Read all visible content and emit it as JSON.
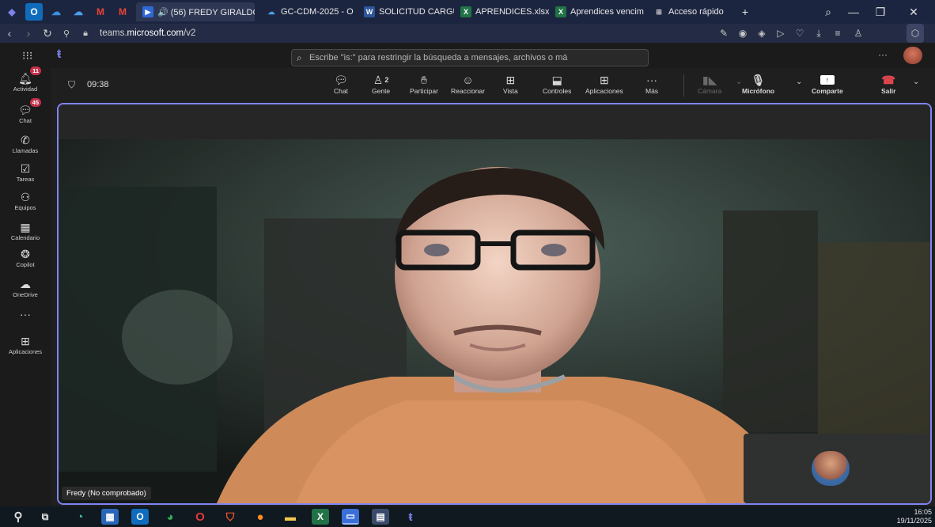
{
  "browser": {
    "tabs": [
      {
        "label": "🔊 (56) FREDY GIRALDO",
        "icon": "youtube-icon",
        "color": "#2f68d8"
      },
      {
        "label": "GC-CDM-2025 - O",
        "icon": "onedrive-icon",
        "color": "#1565c0"
      },
      {
        "label": "SOLICITUD CARGU",
        "icon": "word-icon",
        "color": "#2b579a"
      },
      {
        "label": "APRENDICES.xlsx",
        "icon": "excel-icon",
        "color": "#217346"
      },
      {
        "label": "Aprendices vencim",
        "icon": "excel-icon",
        "color": "#217346"
      },
      {
        "label": "Acceso rápido",
        "icon": "grid-icon",
        "color": "#888888"
      }
    ],
    "url_host": "teams.",
    "url_bold": "microsoft.com",
    "url_path": "/v2"
  },
  "teams": {
    "search_placeholder": "Escribe \"is:\" para restringir la búsqueda a mensajes, archivos o má",
    "more": "···",
    "rail": [
      {
        "label": "Actividad",
        "icon": "bell-icon",
        "badge": "11"
      },
      {
        "label": "Chat",
        "icon": "chat-icon",
        "badge": "45"
      },
      {
        "label": "Llamadas",
        "icon": "phone-icon",
        "badge": ""
      },
      {
        "label": "Tareas",
        "icon": "tasks-icon",
        "badge": ""
      },
      {
        "label": "Equipos",
        "icon": "teams-icon",
        "badge": ""
      },
      {
        "label": "Calendario",
        "icon": "calendar-icon",
        "badge": ""
      },
      {
        "label": "Copilot",
        "icon": "copilot-icon",
        "badge": ""
      },
      {
        "label": "OneDrive",
        "icon": "cloud-icon",
        "badge": ""
      },
      {
        "label": "",
        "icon": "more-icon",
        "badge": ""
      },
      {
        "label": "Aplicaciones",
        "icon": "apps-plus-icon",
        "badge": ""
      }
    ]
  },
  "meeting": {
    "timer": "09:38",
    "participants_count": "2",
    "toolbar": {
      "chat": "Chat",
      "people": "Gente",
      "raise": "Participar",
      "react": "Reaccionar",
      "view": "Vista",
      "controls": "Controles",
      "apps": "Aplicaciones",
      "more": "Más",
      "camera": "Cámara",
      "mic": "Micrófono",
      "share": "Comparte",
      "leave": "Salir"
    },
    "main_participant": "Fredy (No comprobado)"
  },
  "taskbar": {
    "time": "16:05",
    "date": "19/11/2025"
  }
}
